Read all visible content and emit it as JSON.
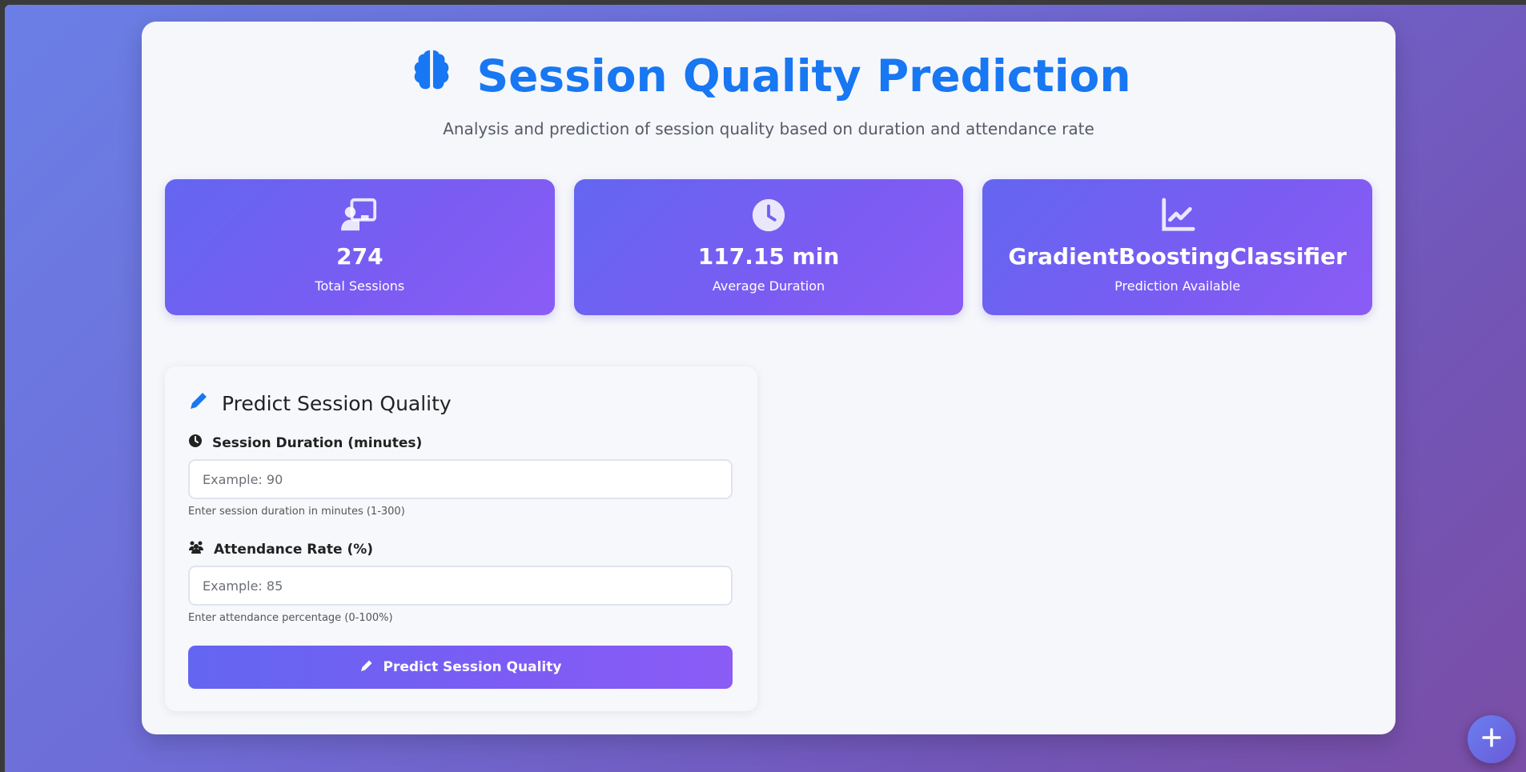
{
  "header": {
    "title": "Session Quality Prediction",
    "title_icon": "brain-icon",
    "subtitle": "Analysis and prediction of session quality based on duration and attendance rate"
  },
  "stats": [
    {
      "icon": "chalkboard-teacher-icon",
      "value": "274",
      "label": "Total Sessions"
    },
    {
      "icon": "clock-icon",
      "value": "117.15 min",
      "label": "Average Duration"
    },
    {
      "icon": "line-chart-icon",
      "value": "GradientBoostingClassifier",
      "label": "Prediction Available"
    }
  ],
  "form": {
    "title": "Predict Session Quality",
    "title_icon": "pencil-icon",
    "duration": {
      "label": "Session Duration (minutes)",
      "icon": "clock-icon",
      "placeholder": "Example: 90",
      "value": "",
      "hint": "Enter session duration in minutes (1-300)"
    },
    "attendance": {
      "label": "Attendance Rate (%)",
      "icon": "users-icon",
      "placeholder": "Example: 85",
      "value": "",
      "hint": "Enter attendance percentage (0-100%)"
    },
    "submit_label": "Predict Session Quality",
    "submit_icon": "pencil-icon"
  },
  "fab": {
    "icon": "plus-icon"
  },
  "colors": {
    "accent": "#1877f2",
    "card_gradient_start": "#6366f1",
    "card_gradient_end": "#8b5cf6",
    "page_background_start": "#6a7fe6",
    "page_background_end": "#7a4ea6"
  }
}
